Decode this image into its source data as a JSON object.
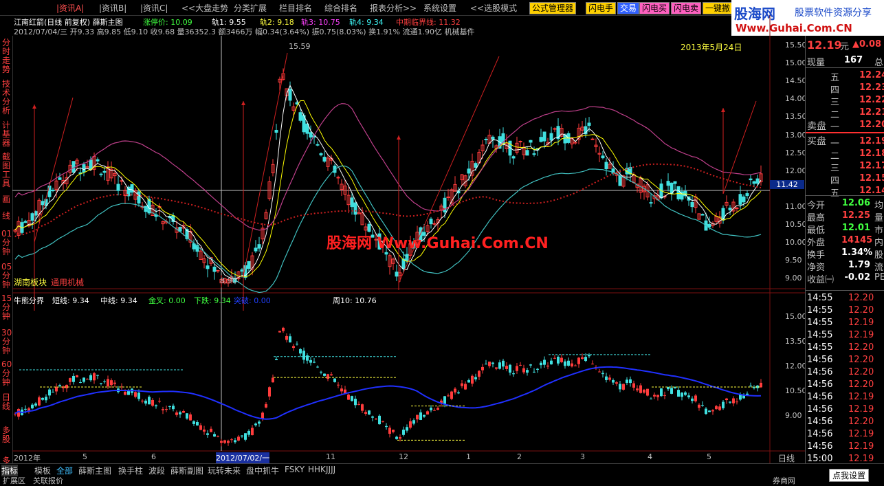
{
  "menu": {
    "items": [
      "|资讯A|",
      "|资讯B|",
      "|资讯C|",
      "<<大盘走势",
      "分类扩展",
      "栏目排名",
      "综合排名",
      "报表分析>>",
      "系统设置",
      "<<选股模式"
    ],
    "buttons": [
      "公式管理器",
      "闪电手",
      "交易",
      "闪电买",
      "闪电卖",
      "一键撤"
    ]
  },
  "brand": {
    "name": "股海网",
    "tagline": "股票软件资源分享",
    "url": "Www.Guhai.Com.CN"
  },
  "stock": {
    "title": "江南红箭(日线 前复权) 薛斯主图",
    "ohlc_line": "2012/07/04/三 开9.33 高9.85 低9.10 收9.68 量36352.3 额3466万 幅0.34(3.64%) 振0.75(8.03%) 换1.91% 流通1.90亿 机械基件",
    "indicators": [
      {
        "label": "涨停价: 10.09",
        "color": "#40ff40"
      },
      {
        "label": "轨1: 9.55",
        "color": "#ffffff"
      },
      {
        "label": "轨2: 9.18",
        "color": "#ffff40"
      },
      {
        "label": "轨3: 10.75",
        "color": "#ff40ff"
      },
      {
        "label": "轨4: 9.34",
        "color": "#40ffff"
      },
      {
        "label": "中期临界线: 11.32",
        "color": "#ff4040"
      }
    ],
    "date_label": "2013年5月24日",
    "watermark": "股海网 Www.Guhai.Com.CN",
    "sector": "湖南板块",
    "industry": "通用机械",
    "high_mark": "15.59",
    "low_mark": "8.90",
    "current_line": "11.42"
  },
  "sub_chart": {
    "title": "牛熊分界",
    "items": [
      {
        "label": "短线: 9.34",
        "color": "#ffffff"
      },
      {
        "label": "中线: 9.34",
        "color": "#ffffff"
      },
      {
        "label": "金叉: 0.00",
        "color": "#40ff40"
      },
      {
        "label": "下跌: 9.34",
        "color": "#40ff40"
      },
      {
        "label": "突破: 0.00",
        "color": "#2040ff"
      },
      {
        "label": "周10: 10.76",
        "color": "#ffffff"
      }
    ]
  },
  "y_axis_main": [
    "15.50",
    "15.00",
    "14.50",
    "14.00",
    "13.50",
    "13.00",
    "12.50",
    "12.00",
    "11.00",
    "10.50",
    "10.00",
    "9.50",
    "9.00"
  ],
  "y_axis_sub": [
    "15.00",
    "13.50",
    "12.00",
    "10.50",
    "9.00"
  ],
  "x_axis": [
    "2012年",
    "5",
    "6",
    "2012/07/02/一",
    "11",
    "12",
    "1",
    "2",
    "3",
    "4",
    "5"
  ],
  "x_axis_right": "日线",
  "quote": {
    "price": "12.19",
    "price_unit": "元",
    "change": "▲0.08",
    "volume_label": "现量",
    "volume": "167",
    "volume_tail": "总",
    "asks": [
      {
        "label": "五",
        "price": "12.24"
      },
      {
        "label": "四",
        "price": "12.23"
      },
      {
        "label": "三",
        "price": "12.22"
      },
      {
        "label": "二",
        "price": "12.21"
      },
      {
        "label": "一",
        "price": "12.20"
      }
    ],
    "bids": [
      {
        "label": "一",
        "price": "12.19"
      },
      {
        "label": "二",
        "price": "12.18"
      },
      {
        "label": "三",
        "price": "12.17"
      },
      {
        "label": "四",
        "price": "12.15"
      },
      {
        "label": "五",
        "price": "12.14"
      }
    ],
    "sell_label": "卖盘",
    "buy_label": "买盘",
    "stats": [
      {
        "label": "今开",
        "value": "12.06",
        "tail": "均",
        "color": "#40ff40"
      },
      {
        "label": "最高",
        "value": "12.25",
        "tail": "量",
        "color": "#ff4040"
      },
      {
        "label": "最低",
        "value": "12.01",
        "tail": "市",
        "color": "#40ff40"
      },
      {
        "label": "外盘",
        "value": "14145",
        "tail": "内",
        "color": "#ff4040"
      },
      {
        "label": "换手",
        "value": "1.34%",
        "tail": "股",
        "color": "#ffffff"
      },
      {
        "label": "净资",
        "value": "1.79",
        "tail": "流",
        "color": "#ffffff"
      },
      {
        "label": "收益㈠",
        "value": "-0.02",
        "tail": "PE",
        "color": "#ffffff"
      }
    ],
    "ticks": [
      {
        "time": "14:55",
        "price": "12.20"
      },
      {
        "time": "14:55",
        "price": "12.20"
      },
      {
        "time": "14:55",
        "price": "12.19"
      },
      {
        "time": "14:55",
        "price": "12.19"
      },
      {
        "time": "14:55",
        "price": "12.20"
      },
      {
        "time": "14:56",
        "price": "12.20"
      },
      {
        "time": "14:56",
        "price": "12.20"
      },
      {
        "time": "14:56",
        "price": "12.20"
      },
      {
        "time": "14:56",
        "price": "12.19"
      },
      {
        "time": "14:56",
        "price": "12.19"
      },
      {
        "time": "14:56",
        "price": "12.20"
      },
      {
        "time": "14:56",
        "price": "12.19"
      },
      {
        "time": "14:56",
        "price": "12.19"
      },
      {
        "time": "15:00",
        "price": "12.19"
      }
    ]
  },
  "left_tabs": [
    "分时走势",
    "技术分析",
    "计基器",
    "截图工具",
    "画",
    "线",
    "01分钟",
    "05分钟",
    "15分钟",
    "30分钟",
    "60分钟",
    "日线",
    "多股",
    "多日"
  ],
  "bottom_tabs": [
    "指标",
    "模板",
    "全部",
    "薛斯主图",
    "换手柱",
    "波段",
    "薛斯副图",
    "玩转未来",
    "盘中抓牛",
    "FSKY",
    "HHK",
    "JJJJ"
  ],
  "bottom_row2": [
    "扩展区",
    "关联报价"
  ],
  "bottom_right": [
    "券商网",
    "点我设置"
  ],
  "colors": {
    "up": "#ff3c3c",
    "down": "#40e0e0",
    "ma_white": "#ffffff",
    "ma_yellow": "#ffff00",
    "band_magenta": "#c0408c",
    "band_cyan": "#40c0c0",
    "dotted_red": "#d02020",
    "sub_blue": "#2030ff"
  }
}
